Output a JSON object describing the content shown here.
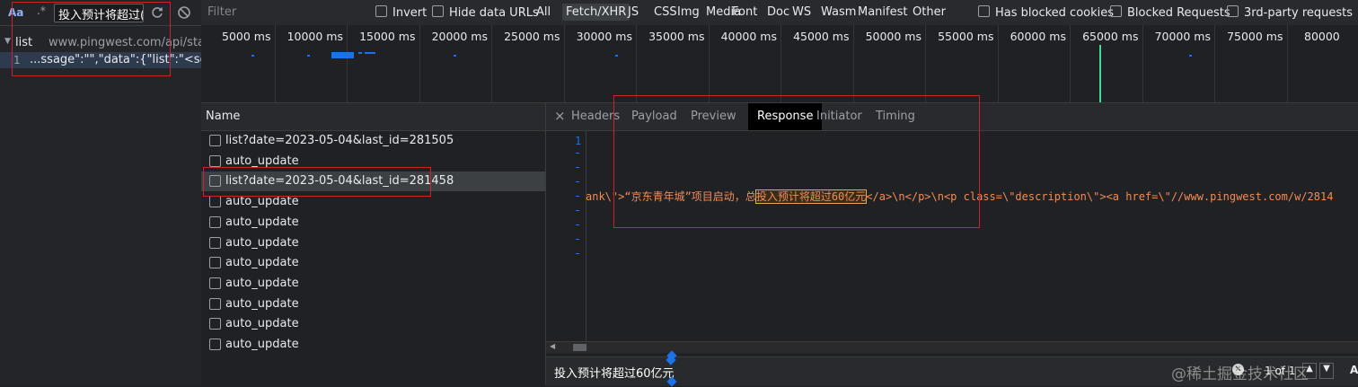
{
  "search": {
    "match_case_label": "Aa",
    "regex_label": ".*",
    "query": "投入预计将超过(",
    "result_group": {
      "name": "list",
      "url": "www.pingwest.com/api/stat..."
    },
    "result_line": {
      "number": "1",
      "text": "...ssage\":\"\",\"data\":{\"list\":\"<secti..."
    }
  },
  "filter": {
    "placeholder": "Filter",
    "invert": "Invert",
    "hide_data_urls": "Hide data URLs",
    "types": [
      "All",
      "Fetch/XHR",
      "JS",
      "CSS",
      "Img",
      "Media",
      "Font",
      "Doc",
      "WS",
      "Wasm",
      "Manifest",
      "Other"
    ],
    "active_type": "Fetch/XHR",
    "has_blocked_cookies": "Has blocked cookies",
    "blocked_requests": "Blocked Requests",
    "third_party": "3rd-party requests"
  },
  "overview": {
    "ticks": [
      "5000 ms",
      "10000 ms",
      "15000 ms",
      "20000 ms",
      "25000 ms",
      "30000 ms",
      "35000 ms",
      "40000 ms",
      "45000 ms",
      "50000 ms",
      "55000 ms",
      "60000 ms",
      "65000 ms",
      "70000 ms",
      "75000 ms",
      "80000"
    ]
  },
  "requests": {
    "header": "Name",
    "rows": [
      "list?date=2023-05-04&last_id=281505",
      "auto_update",
      "list?date=2023-05-04&last_id=281458",
      "auto_update",
      "auto_update",
      "auto_update",
      "auto_update",
      "auto_update",
      "auto_update",
      "auto_update",
      "auto_update"
    ],
    "selected_index": 2
  },
  "detail": {
    "close_symbol": "×",
    "tabs": [
      "Headers",
      "Payload",
      "Preview",
      "Response",
      "Initiator",
      "Timing"
    ],
    "active_tab": "Response",
    "line_number": "1",
    "code_before": "ank\\\">“京东青年城”项目启动，总",
    "code_highlight": "投入预计将超过60亿元",
    "code_after": "</a>\\n</p>\\n<p class=\\\"description\\\"><a href=\\\"//www.pingwest.com/w/2814",
    "find_query": "投入预计将超过60亿元",
    "find_count": "1 of 1",
    "watermark": "@稀土掘金技术社区"
  }
}
